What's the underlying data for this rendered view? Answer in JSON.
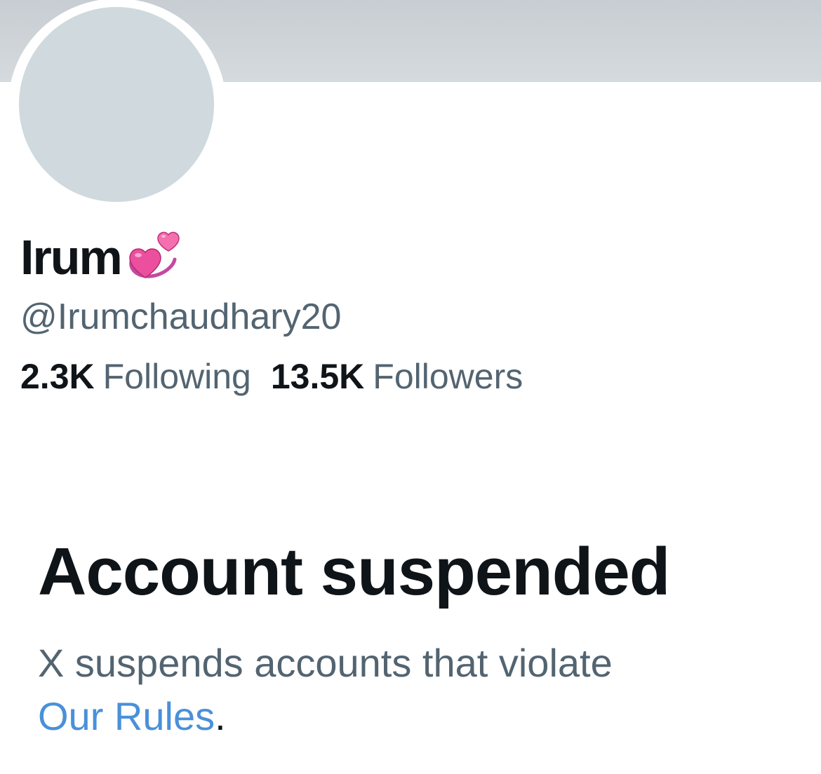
{
  "profile": {
    "display_name": "Irum",
    "name_emoji": "💞",
    "handle": "@Irumchaudhary20",
    "following_count": "2.3K",
    "following_label": "Following",
    "followers_count": "13.5K",
    "followers_label": "Followers"
  },
  "suspension": {
    "title": "Account suspended",
    "description": "X suspends accounts that violate",
    "rules_link": "Our Rules",
    "period": "."
  },
  "colors": {
    "banner": "#cdd3d7",
    "avatar_placeholder": "#cfd9de",
    "primary_text": "#0f1419",
    "secondary_text": "#536471",
    "link": "#4a90d9",
    "hearts": "#e8408f"
  },
  "icons": {
    "name_badge": "revolving-hearts-icon"
  }
}
